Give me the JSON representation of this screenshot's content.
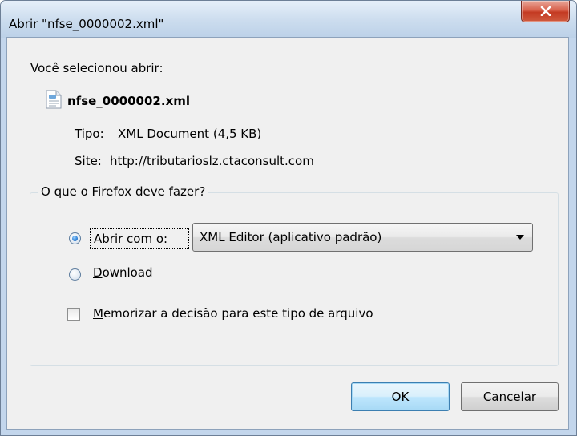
{
  "window": {
    "title": "Abrir \"nfse_0000002.xml\""
  },
  "dialog": {
    "intro": "Você selecionou abrir:",
    "file_name": "nfse_0000002.xml",
    "type_label": "Tipo:",
    "type_value": "XML Document (4,5 KB)",
    "site_label": "Site:",
    "site_value": "http://tributarioslz.ctaconsult.com"
  },
  "action_group": {
    "label": "O que o Firefox deve fazer?",
    "open_with": {
      "mnemonic": "A",
      "label_rest": "brir com o:",
      "selected": true
    },
    "app_select": {
      "value": "XML Editor (aplicativo padrão)"
    },
    "download": {
      "mnemonic": "D",
      "label_rest": "ownload",
      "selected": false
    },
    "remember": {
      "mnemonic": "M",
      "label_rest": "emorizar a decisão para este tipo de arquivo",
      "checked": false
    }
  },
  "buttons": {
    "ok": "OK",
    "cancel": "Cancelar"
  },
  "icons": {
    "close": "close-icon",
    "file": "xml-file-icon",
    "dropdown": "chevron-down-icon"
  },
  "colors": {
    "close_button": "#c43a22",
    "default_button_border": "#3c7fb1",
    "title_bar": "#cbdcee",
    "client_bg": "#f0f0f0"
  }
}
